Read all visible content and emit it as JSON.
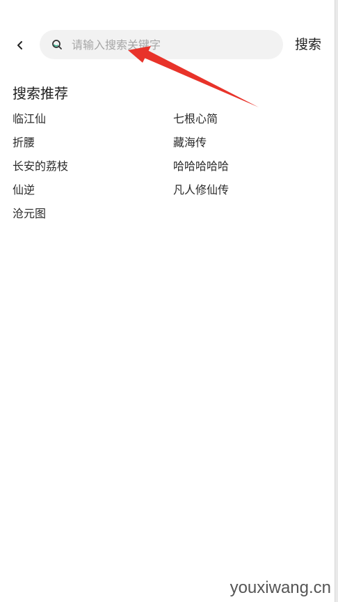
{
  "header": {
    "back_icon": "chevron-left-icon",
    "search": {
      "icon": "search-icon",
      "placeholder": "请输入搜索关键字",
      "value": ""
    },
    "search_button_label": "搜索"
  },
  "recommend": {
    "title": "搜索推荐",
    "items": [
      {
        "label": "临江仙"
      },
      {
        "label": "七根心简"
      },
      {
        "label": "折腰"
      },
      {
        "label": "藏海传"
      },
      {
        "label": "长安的荔枝"
      },
      {
        "label": "哈哈哈哈哈"
      },
      {
        "label": "仙逆"
      },
      {
        "label": "凡人修仙传"
      },
      {
        "label": "沧元图"
      }
    ]
  },
  "annotation": {
    "arrow_color": "#e8332a"
  },
  "watermark": "youxiwang.cn",
  "colors": {
    "search_bg": "#f2f2f2",
    "search_icon_accent": "#2bb38a",
    "text": "#222222",
    "placeholder": "#a6a6a6"
  }
}
